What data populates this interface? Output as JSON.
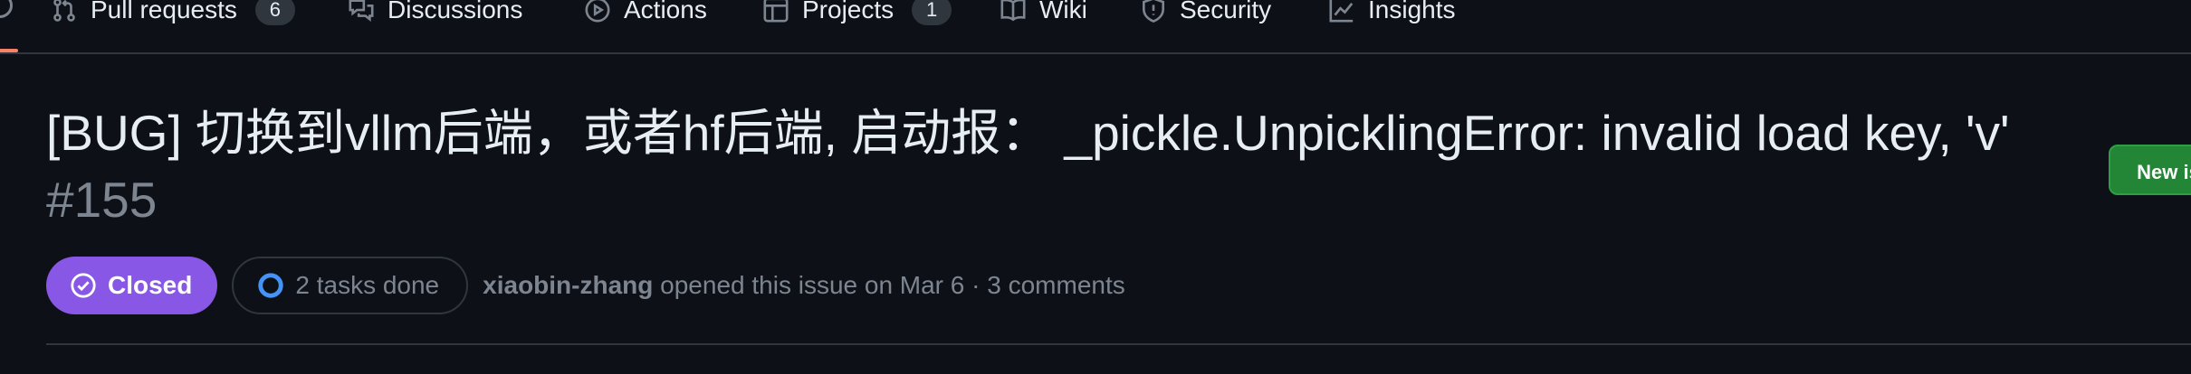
{
  "nav": {
    "pull_requests": {
      "label": "Pull requests",
      "count": "6"
    },
    "discussions": {
      "label": "Discussions"
    },
    "actions": {
      "label": "Actions"
    },
    "projects": {
      "label": "Projects",
      "count": "1"
    },
    "wiki": {
      "label": "Wiki"
    },
    "security": {
      "label": "Security"
    },
    "insights": {
      "label": "Insights"
    }
  },
  "issue": {
    "title": "[BUG] 切换到vllm后端，或者hf后端, 启动报： _pickle.UnpicklingError: invalid load key, 'v'",
    "number": "#155",
    "state": "Closed",
    "tasks": "2 tasks done",
    "author": "xiaobin-zhang",
    "opened_text": "opened this issue on Mar 6 · 3 comments"
  },
  "actions": {
    "new_issue_label": "New is"
  },
  "colors": {
    "background": "#0d1117",
    "closed_badge": "#8957e5",
    "new_issue_button": "#238636",
    "active_tab_underline": "#f78166",
    "border": "#30363d",
    "muted_text": "#7d8590"
  },
  "icons": {
    "pull_requests": "git-pull-request-icon",
    "discussions": "comment-discussion-icon",
    "actions": "play-icon",
    "projects": "table-icon",
    "wiki": "book-icon",
    "security": "shield-icon",
    "insights": "graph-icon",
    "state": "check-circle-icon",
    "tasks": "progress-circle-icon"
  }
}
